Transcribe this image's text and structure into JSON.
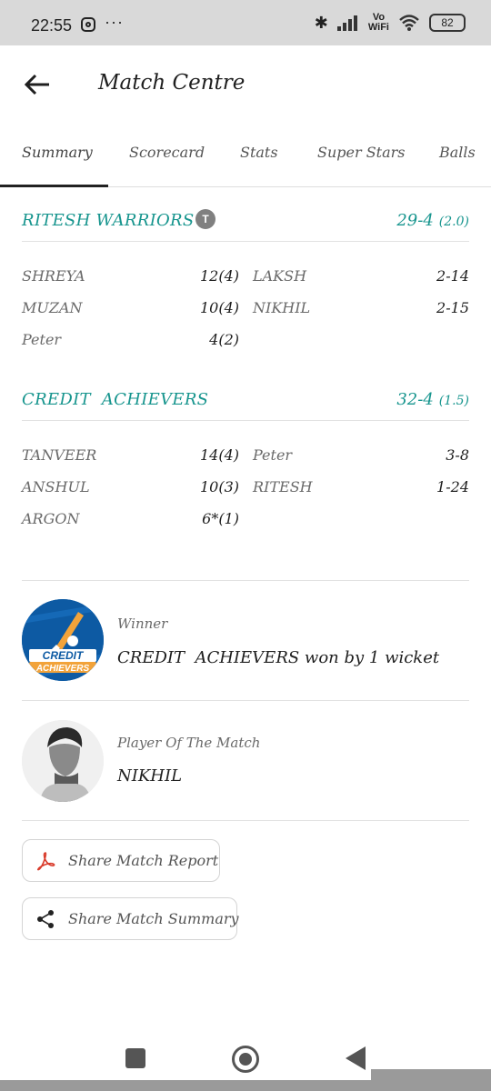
{
  "status_bar": {
    "time": "22:55",
    "dots": "···",
    "vo_wifi_top": "Vo",
    "vo_wifi_bottom": "WiFi",
    "battery": "82"
  },
  "app_bar": {
    "title": "Match Centre",
    "back_icon": "arrow-left-icon"
  },
  "tabs": [
    {
      "label": "Summary",
      "active": true
    },
    {
      "label": "Scorecard"
    },
    {
      "label": "Stats"
    },
    {
      "label": "Super Stars"
    },
    {
      "label": "Balls"
    }
  ],
  "innings": [
    {
      "team": "RITESH WARRIORS",
      "toss_badge": "T",
      "score": "29-4",
      "overs": "(2.0)",
      "rows": [
        {
          "batter": "SHREYA",
          "runs": "12(4)",
          "bowler": "LAKSH",
          "figures": "2-14"
        },
        {
          "batter": "MUZAN",
          "runs": "10(4)",
          "bowler": "NIKHIL",
          "figures": "2-15"
        },
        {
          "batter": "Peter",
          "runs": "4(2)",
          "bowler": "",
          "figures": ""
        }
      ]
    },
    {
      "team": "CREDIT  ACHIEVERS",
      "score": "32-4",
      "overs": "(1.5)",
      "rows": [
        {
          "batter": "TANVEER",
          "runs": "14(4)",
          "bowler": "Peter",
          "figures": "3-8"
        },
        {
          "batter": "ANSHUL",
          "runs": "10(3)",
          "bowler": "RITESH",
          "figures": "1-24"
        },
        {
          "batter": "ARGON",
          "runs": "6*(1)",
          "bowler": "",
          "figures": ""
        }
      ]
    }
  ],
  "winner": {
    "label": "Winner",
    "text": "CREDIT  ACHIEVERS won by 1 wicket",
    "logo_text_1": "CREDIT",
    "logo_text_2": "ACHIEVERS"
  },
  "player_of_match": {
    "label": "Player Of The Match",
    "name": "NIKHIL"
  },
  "share": {
    "report_label": "Share Match Report",
    "summary_label": "Share Match Summary"
  },
  "colors": {
    "accent": "#17958e",
    "tab_indicator": "#222222"
  }
}
